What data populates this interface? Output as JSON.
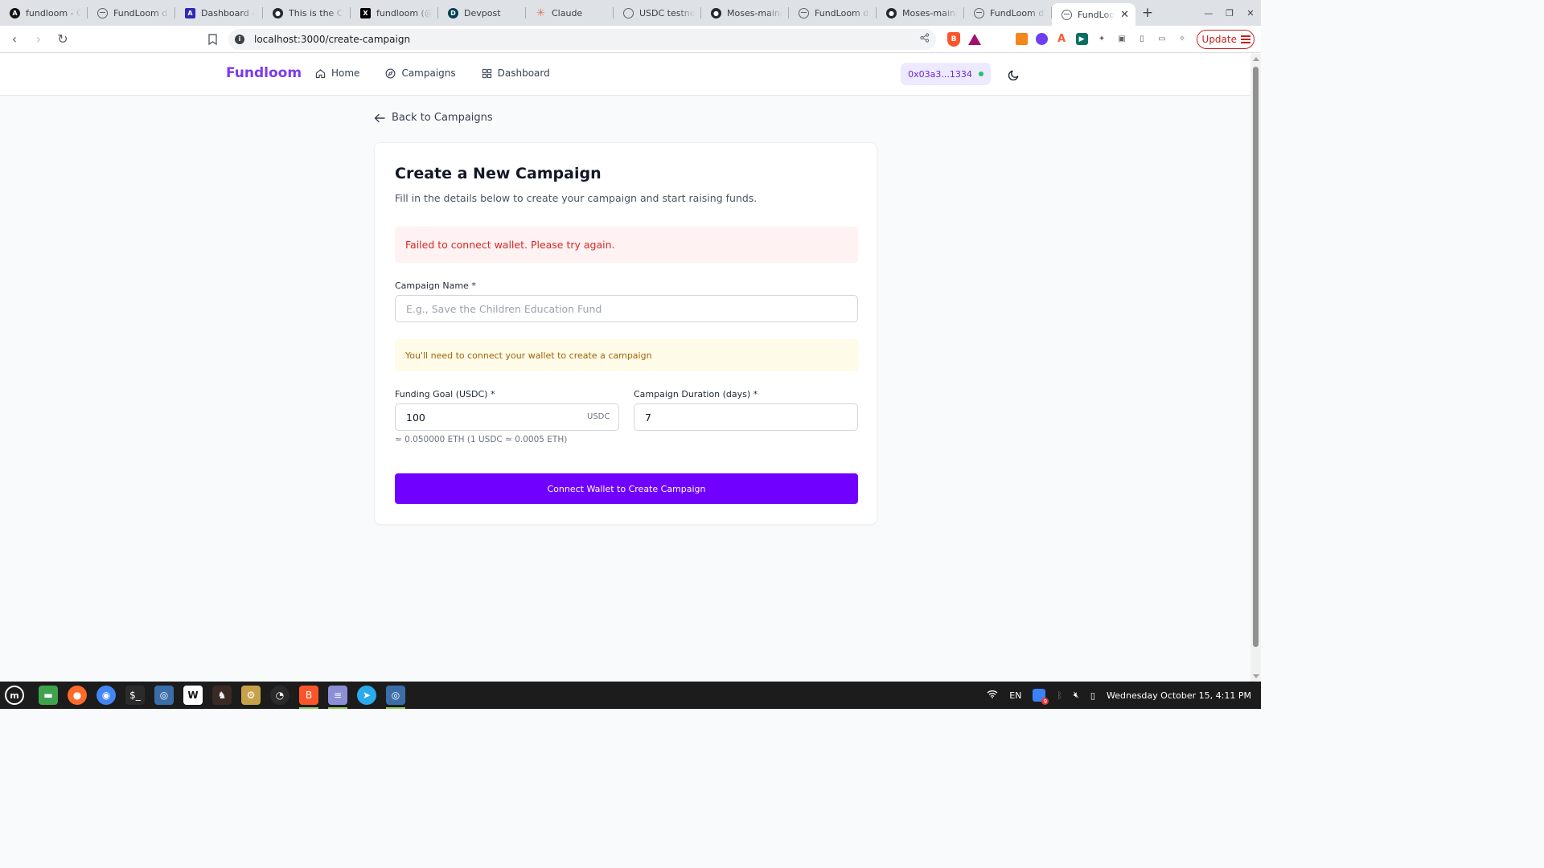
{
  "browser": {
    "tabs": [
      {
        "title": "fundloom - Ov",
        "icon": "circle-a-icon"
      },
      {
        "title": "FundLoom dA",
        "icon": "globe-icon"
      },
      {
        "title": "Dashboard - A",
        "icon": "triangle-a-icon"
      },
      {
        "title": "This is the Cai",
        "icon": "github-icon"
      },
      {
        "title": "fundloom (@F",
        "icon": "x-icon"
      },
      {
        "title": "Devpost",
        "icon": "devpost-icon"
      },
      {
        "title": "Claude",
        "icon": "claude-icon"
      },
      {
        "title": "USDC testnet",
        "icon": "usdc-icon"
      },
      {
        "title": "Moses-main/f",
        "icon": "github-icon"
      },
      {
        "title": "FundLoom dA",
        "icon": "globe-icon"
      },
      {
        "title": "Moses-main/f",
        "icon": "github-icon"
      },
      {
        "title": "FundLoom dA",
        "icon": "globe-icon"
      },
      {
        "title": "FundLoo",
        "icon": "globe-icon",
        "active": true
      }
    ],
    "url": "localhost:3000/create-campaign",
    "update_label": "Update"
  },
  "header": {
    "brand": "Fundloom",
    "nav": [
      {
        "label": "Home",
        "icon": "home-icon"
      },
      {
        "label": "Campaigns",
        "icon": "compass-icon"
      },
      {
        "label": "Dashboard",
        "icon": "grid-icon"
      }
    ],
    "wallet_address": "0x03a3...1334",
    "wallet_status_color": "#22c55e"
  },
  "back_link": "Back to Campaigns",
  "form": {
    "title": "Create a New Campaign",
    "subtitle": "Fill in the details below to create your campaign and start raising funds.",
    "error": "Failed to connect wallet. Please try again.",
    "name_label": "Campaign Name *",
    "name_placeholder": "E.g., Save the Children Education Fund",
    "name_value": "",
    "wallet_warning": "You'll need to connect your wallet to create a campaign",
    "goal_label": "Funding Goal (USDC) *",
    "goal_value": "100",
    "goal_suffix": "USDC",
    "goal_hint": "≈ 0.050000 ETH (1 USDC ≈ 0.0005 ETH)",
    "duration_label": "Campaign Duration (days) *",
    "duration_value": "7",
    "submit_label": "Connect Wallet to Create Campaign"
  },
  "colors": {
    "brand": "#7c3aed",
    "primary_button": "#7000ff",
    "error_text": "#dc2626",
    "error_bg": "#fef2f2",
    "warning_text": "#a16207",
    "warning_bg": "#fefce8"
  },
  "taskbar": {
    "keyboard_layout": "EN",
    "clock": "Wednesday October 15, 4:11 PM"
  }
}
